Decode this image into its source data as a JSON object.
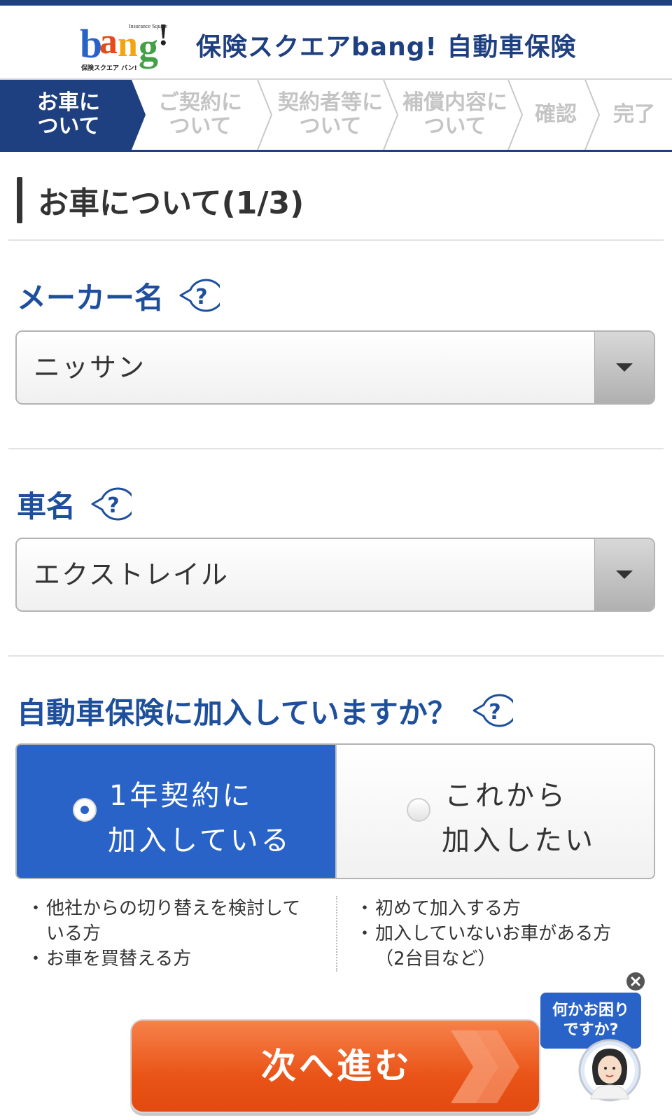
{
  "header": {
    "logo_text": "bang!",
    "logo_sub_top": "Insurance Square",
    "logo_sub_bottom": "保険スクエア バン!",
    "title": "保険スクエアbang! 自動車保険"
  },
  "steps": [
    {
      "label": "お車に\nついて",
      "active": true
    },
    {
      "label": "ご契約に\nついて",
      "active": false
    },
    {
      "label": "契約者等に\nついて",
      "active": false
    },
    {
      "label": "補償内容に\nついて",
      "active": false
    },
    {
      "label": "確認",
      "active": false
    },
    {
      "label": "完了",
      "active": false
    }
  ],
  "section": {
    "title": "お車について(1/3)"
  },
  "fields": {
    "maker": {
      "label": "メーカー名",
      "value": "ニッサン"
    },
    "car_name": {
      "label": "車名",
      "value": "エクストレイル"
    },
    "insurance_status": {
      "label": "自動車保険に加入していますか？",
      "options": [
        {
          "line1": "1年契約に",
          "line2": "加入している",
          "selected": true
        },
        {
          "line1": "これから",
          "line2": "加入したい",
          "selected": false
        }
      ],
      "notes_left": [
        "他社からの切り替えを検討して\nいる方",
        "お車を買替える方"
      ],
      "notes_right": [
        "初めて加入する方",
        "加入していないお車がある方\n（2台目など）"
      ]
    }
  },
  "next_button": {
    "label": "次へ進む"
  },
  "help_chat": {
    "line1": "何かお困り",
    "line2": "ですか?"
  },
  "colors": {
    "brand_navy": "#1e3f80",
    "label_blue": "#1e4f9c",
    "selected_blue": "#2a63c7",
    "button_orange": "#ea5418"
  },
  "icons": {
    "help": "question-bubble-icon",
    "select": "dropdown-triangle-icon",
    "next": "double-chevron-right-icon",
    "close": "close-circle-icon"
  }
}
